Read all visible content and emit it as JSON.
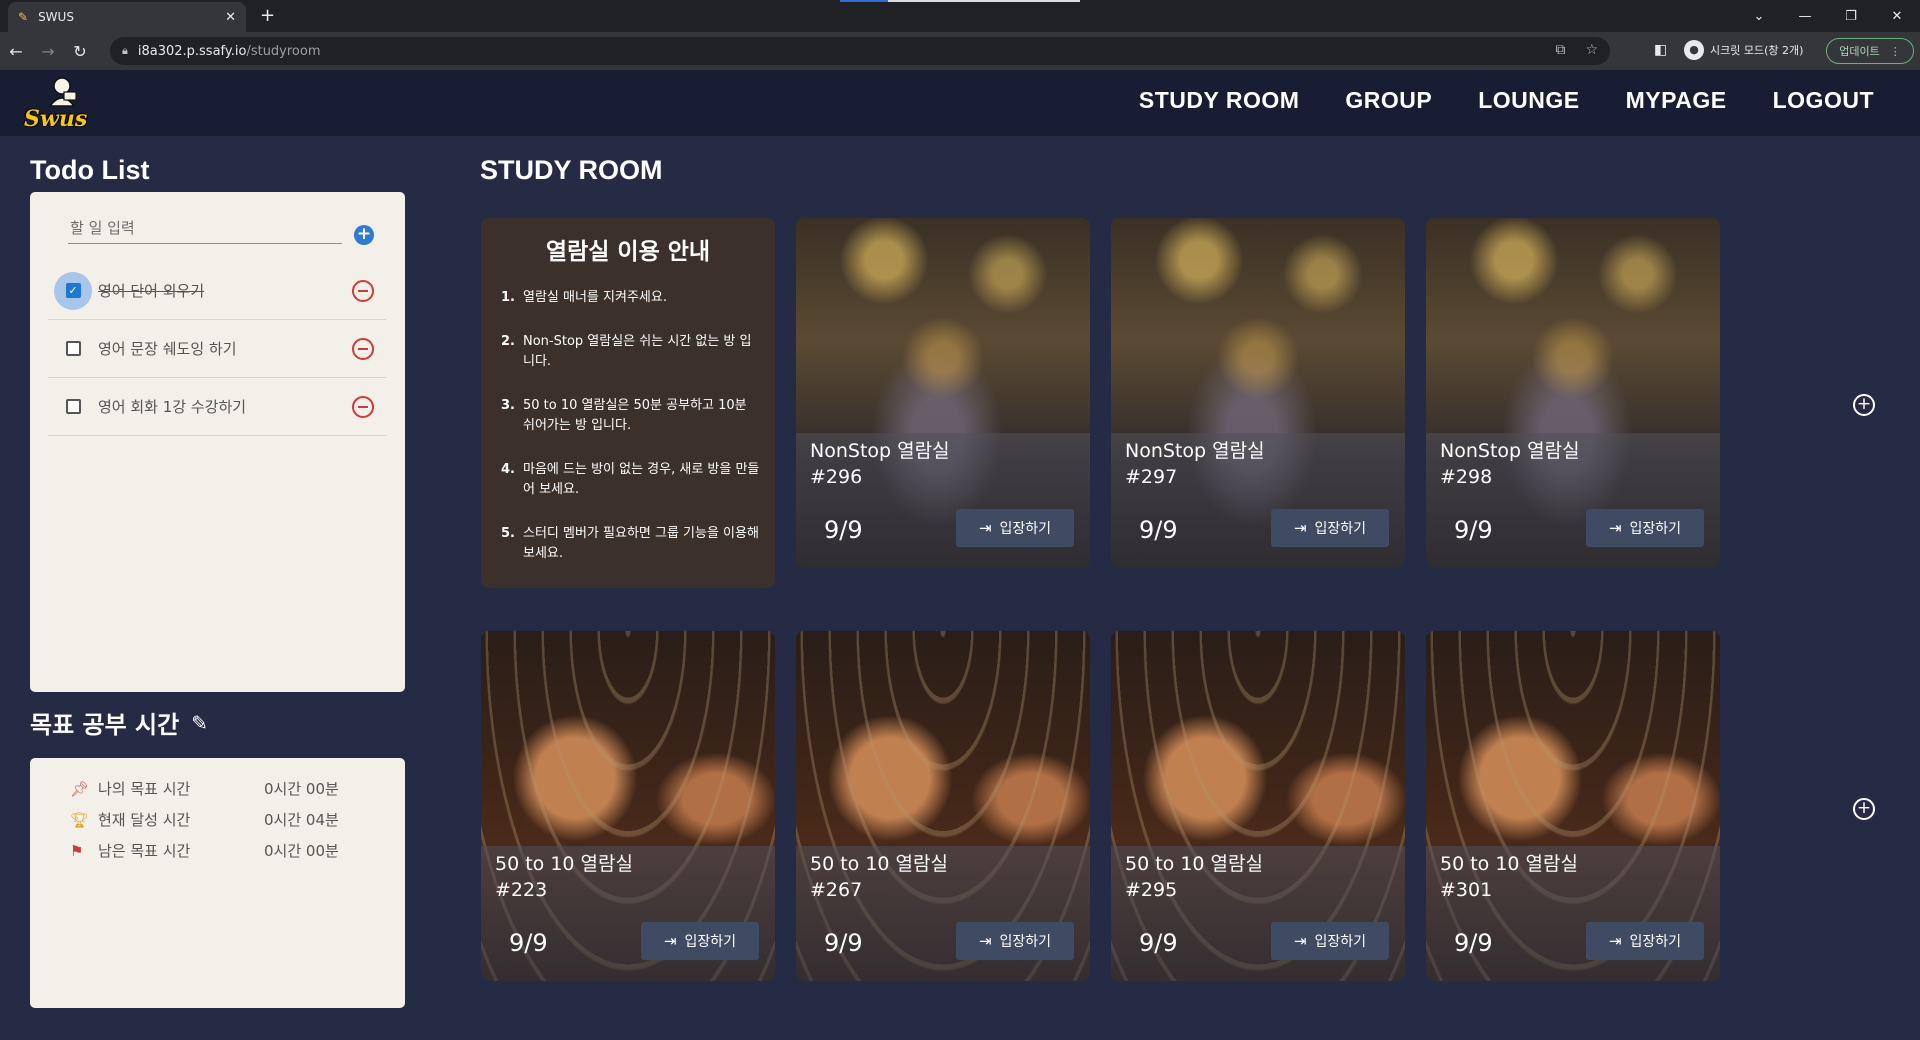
{
  "browser": {
    "tab_title": "SWUS",
    "url_host": "i8a302.p.ssafy.io",
    "url_path": "/studyroom",
    "profile_label": "시크릿 모드(창 2개)",
    "update_label": "업데이트"
  },
  "header": {
    "logo_text": "Swus",
    "nav": [
      "STUDY ROOM",
      "GROUP",
      "LOUNGE",
      "MYPAGE",
      "LOGOUT"
    ]
  },
  "todo": {
    "title": "Todo List",
    "input_placeholder": "할 일 입력",
    "items": [
      {
        "label": "영어 단어 외우기",
        "done": true
      },
      {
        "label": "영어 문장 쉐도잉 하기",
        "done": false
      },
      {
        "label": "영어 회화 1강 수강하기",
        "done": false
      }
    ]
  },
  "goal": {
    "title": "목표 공부 시간",
    "rows": [
      {
        "icon": "pin-icon",
        "label": "나의 목표 시간",
        "value": "0시간 00분"
      },
      {
        "icon": "trophy-icon",
        "label": "현재 달성 시간",
        "value": "0시간 04분"
      },
      {
        "icon": "flag-icon",
        "label": "남은 목표 시간",
        "value": "0시간 00분"
      }
    ]
  },
  "main": {
    "title": "STUDY ROOM",
    "guide": {
      "title": "열람실 이용 안내",
      "items": [
        "열람실 매너를 지켜주세요.",
        "Non-Stop 열람실은 쉬는 시간 없는 방 입니다.",
        "50 to 10 열람실은 50분 공부하고 10분 쉬어가는 방 입니다.",
        "마음에 드는 방이 없는 경우, 새로 방을 만들어 보세요.",
        "스터디 멤버가 필요하면 그룹 기능을 이용해 보세요."
      ]
    },
    "enter_label": "입장하기",
    "nonstop_rooms": [
      {
        "name": "NonStop 열람실",
        "no": "#296",
        "count": "9/9"
      },
      {
        "name": "NonStop 열람실",
        "no": "#297",
        "count": "9/9"
      },
      {
        "name": "NonStop 열람실",
        "no": "#298",
        "count": "9/9"
      }
    ],
    "fifty_rooms": [
      {
        "name": "50 to 10 열람실",
        "no": "#223",
        "count": "9/9"
      },
      {
        "name": "50 to 10 열람실",
        "no": "#267",
        "count": "9/9"
      },
      {
        "name": "50 to 10 열람실",
        "no": "#295",
        "count": "9/9"
      },
      {
        "name": "50 to 10 열람실",
        "no": "#301",
        "count": "9/9"
      }
    ]
  }
}
